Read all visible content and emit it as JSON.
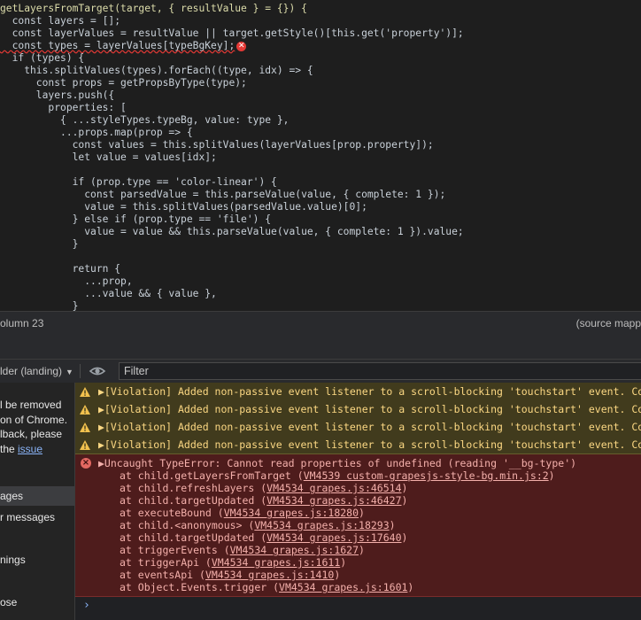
{
  "editor": {
    "lines": [
      "getLayersFromTarget(target, { resultValue } = {}) {",
      "  const layers = [];",
      "  const layerValues = resultValue || target.getStyle()[this.get('property')];",
      "  const types = layerValues[typeBgKey];",
      "  if (types) {",
      "    this.splitValues(types).forEach((type, idx) => {",
      "      const props = getPropsByType(type);",
      "      layers.push({",
      "        properties: [",
      "          { ...styleTypes.typeBg, value: type },",
      "          ...props.map(prop => {",
      "            const values = this.splitValues(layerValues[prop.property]);",
      "            let value = values[idx];",
      "",
      "            if (prop.type == 'color-linear') {",
      "              const parsedValue = this.parseValue(value, { complete: 1 });",
      "              value = this.splitValues(parsedValue.value)[0];",
      "            } else if (prop.type == 'file') {",
      "              value = value && this.parseValue(value, { complete: 1 }).value;",
      "            }",
      "",
      "            return {",
      "              ...prop,",
      "              ...value && { value },",
      "            }"
    ]
  },
  "status": {
    "position": "olumn 23",
    "source_map": "(source mapp"
  },
  "toolbar": {
    "context": "lder (landing)",
    "filter_placeholder": "Filter"
  },
  "sidebar": {
    "notice_lines": [
      "l be removed",
      "on of Chrome.",
      "lback, please"
    ],
    "notice_prefix": "the ",
    "notice_link": "issue",
    "items": [
      "ages",
      "r messages",
      "",
      "nings",
      "",
      "ose"
    ]
  },
  "console": {
    "warnings": [
      "▶[Violation] Added non-passive event listener to a scroll-blocking 'touchstart' event. Consid",
      "▶[Violation] Added non-passive event listener to a scroll-blocking 'touchstart' event. Consid",
      "▶[Violation] Added non-passive event listener to a scroll-blocking 'touchstart' event. Consid",
      "▶[Violation] Added non-passive event listener to a scroll-blocking 'touchstart' event. Consid"
    ],
    "error_message": "▶Uncaught TypeError: Cannot read properties of undefined (reading '__bg-type')",
    "stack": [
      {
        "at": "at child.getLayersFromTarget (",
        "link": "VM4539 custom-grapesjs-style-bg.min.js:2",
        "end": ")"
      },
      {
        "at": "at child.refreshLayers (",
        "link": "VM4534 grapes.js:46514",
        "end": ")"
      },
      {
        "at": "at child.targetUpdated (",
        "link": "VM4534 grapes.js:46427",
        "end": ")"
      },
      {
        "at": "at executeBound (",
        "link": "VM4534 grapes.js:18280",
        "end": ")"
      },
      {
        "at": "at child.<anonymous> (",
        "link": "VM4534 grapes.js:18293",
        "end": ")"
      },
      {
        "at": "at child.targetUpdated (",
        "link": "VM4534 grapes.js:17640",
        "end": ")"
      },
      {
        "at": "at triggerEvents (",
        "link": "VM4534 grapes.js:1627",
        "end": ")"
      },
      {
        "at": "at triggerApi (",
        "link": "VM4534 grapes.js:1611",
        "end": ")"
      },
      {
        "at": "at eventsApi (",
        "link": "VM4534 grapes.js:1410",
        "end": ")"
      },
      {
        "at": "at Object.Events.trigger (",
        "link": "VM4534 grapes.js:1601",
        "end": ")"
      }
    ],
    "prompt": "›"
  },
  "colors": {
    "editor_bg": "#1e1e1e",
    "warning_bg": "#413b1d",
    "warning_text": "#fcd883",
    "error_bg": "#4e1c1c",
    "error_text": "#f4b0ab",
    "link": "#8ab4f8"
  },
  "icons": [
    "error-icon",
    "eye-icon",
    "warning-icon",
    "error-circle-icon",
    "dropdown-caret-icon"
  ]
}
